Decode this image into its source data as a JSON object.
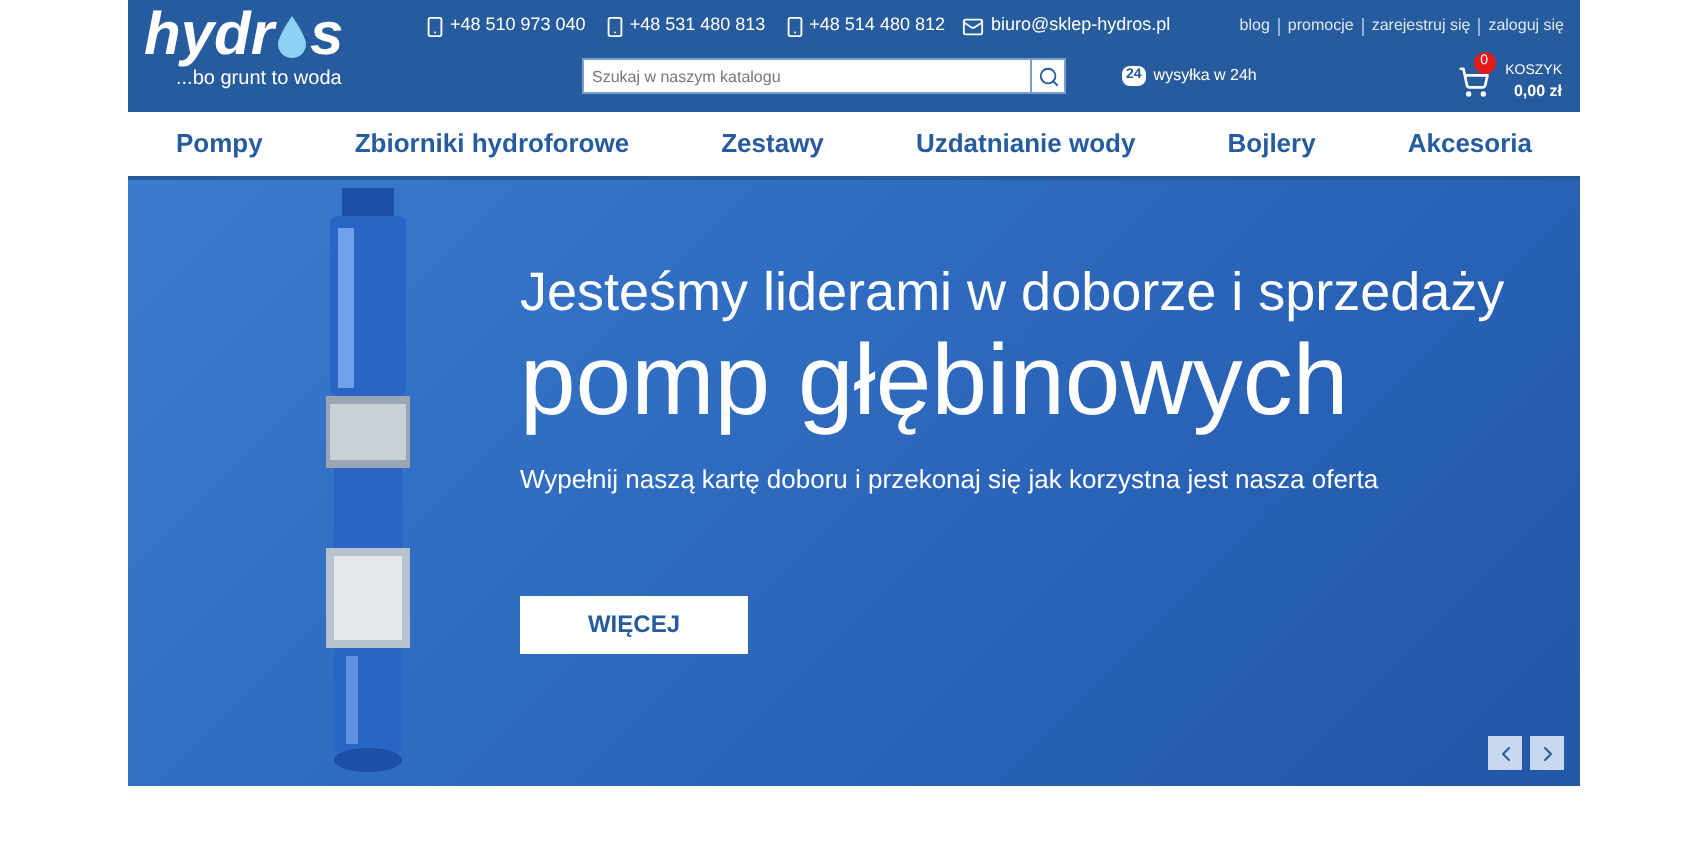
{
  "header": {
    "logo": {
      "text_before": "hydr",
      "text_after": "s",
      "tagline": "...bo grunt to woda"
    },
    "phones": [
      "+48 510 973 040",
      "+48 531 480 813",
      "+48 514 480 812"
    ],
    "email": "biuro@sklep-hydros.pl",
    "links": [
      "blog",
      "promocje",
      "zarejestruj się",
      "zaloguj się"
    ],
    "search": {
      "placeholder": "Szukaj w naszym katalogu"
    },
    "shipping": {
      "badge": "24",
      "label": "wysyłka w 24h"
    },
    "cart": {
      "count": "0",
      "label": "KOSZYK",
      "total": "0,00 zł"
    }
  },
  "nav": [
    "Pompy",
    "Zbiorniki hydroforowe",
    "Zestawy",
    "Uzdatnianie wody",
    "Bojlery",
    "Akcesoria"
  ],
  "banner": {
    "kind": "picture",
    "subtitle": "Jesteśmy liderami w doborze i sprzedaży",
    "title": "pomp głębinowych",
    "text": "Wypełnij naszą kartę doboru i przekonaj się jak korzystna jest nasza oferta",
    "button": "WIĘCEJ"
  }
}
